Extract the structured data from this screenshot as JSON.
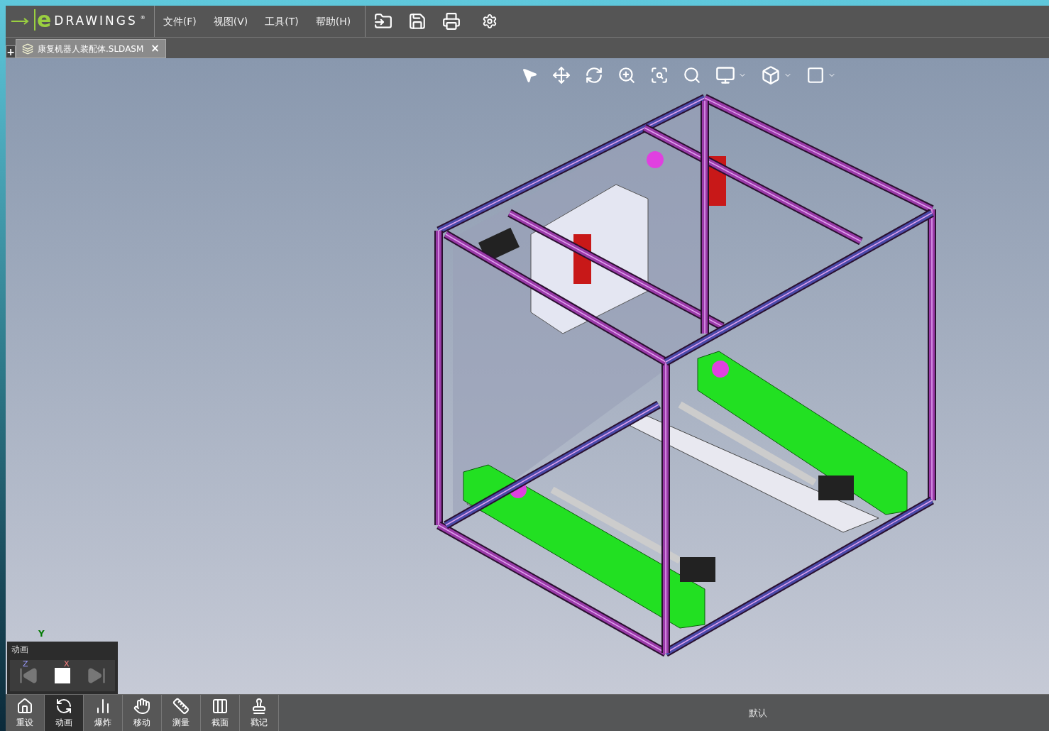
{
  "app": {
    "logo_letter": "e",
    "logo_word": "DRAWINGS",
    "logo_mark": "®"
  },
  "menu": [
    "文件(F)",
    "视图(V)",
    "工具(T)",
    "帮助(H)"
  ],
  "tabs": [
    {
      "label": "康复机器人装配体.SLDASM",
      "selected": true,
      "close": "×"
    }
  ],
  "new_tab": "+",
  "animation_panel": {
    "title": "动画"
  },
  "axes": {
    "y": "Y",
    "x": "X",
    "z": "Z"
  },
  "bottom_tools": [
    {
      "label": "重设",
      "kind": "home",
      "selected": false
    },
    {
      "label": "动画",
      "kind": "animate",
      "selected": true
    },
    {
      "label": "爆炸",
      "kind": "explode",
      "selected": false
    },
    {
      "label": "移动",
      "kind": "move",
      "selected": false
    },
    {
      "label": "测量",
      "kind": "measure",
      "selected": false
    },
    {
      "label": "截面",
      "kind": "section",
      "selected": false
    },
    {
      "label": "戳记",
      "kind": "stamp",
      "selected": false
    }
  ],
  "configuration": "默认"
}
